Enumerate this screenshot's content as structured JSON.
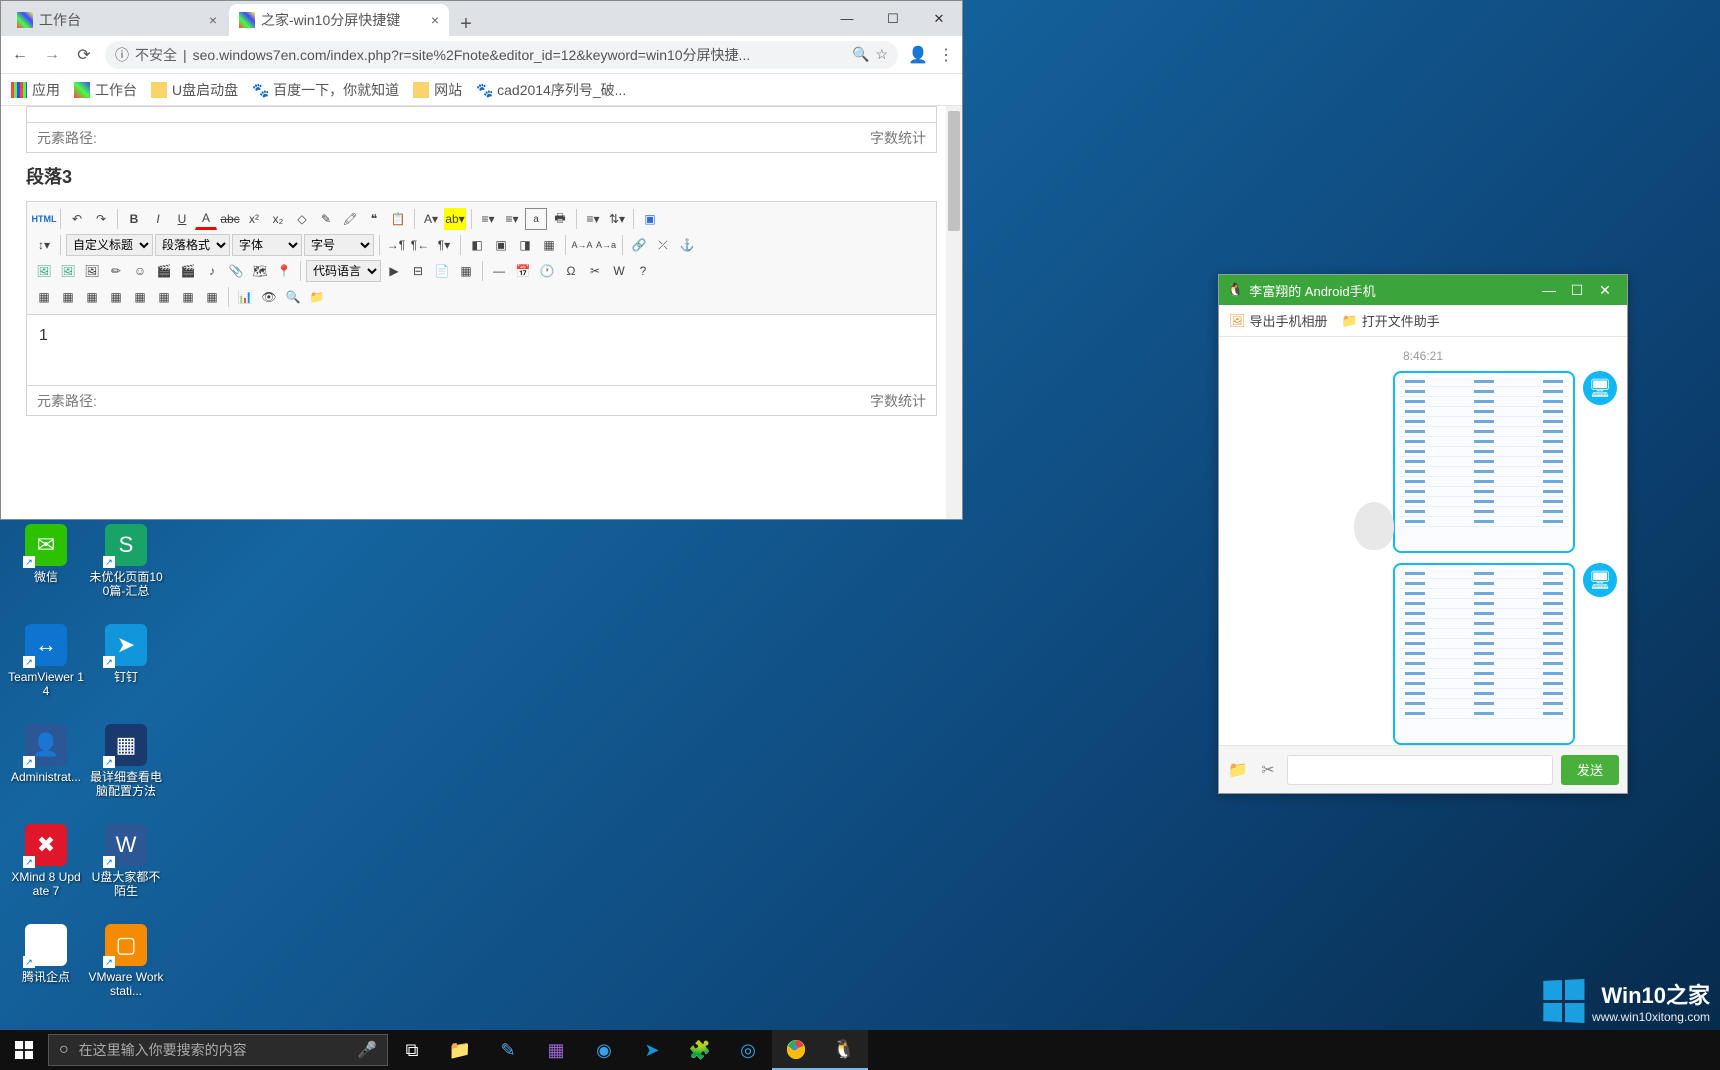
{
  "browser": {
    "tabs": [
      {
        "title": "工作台"
      },
      {
        "title": "之家-win10分屏快捷键"
      }
    ],
    "address": {
      "insecure_label": "不安全",
      "url": "seo.windows7en.com/index.php?r=site%2Fnote&editor_id=12&keyword=win10分屏快捷..."
    },
    "bookmarks": {
      "apps": "应用",
      "items": [
        "工作台",
        "U盘启动盘",
        "百度一下，你就知道",
        "网站",
        "cad2014序列号_破..."
      ]
    },
    "page": {
      "path_label": "元素路径:",
      "count_label": "字数统计",
      "section_title": "段落3",
      "toolbar": {
        "html": "HTML",
        "custom_title": "自定义标题",
        "para_fmt": "段落格式",
        "font": "字体",
        "size": "字号",
        "code_lang": "代码语言"
      },
      "content": "1"
    }
  },
  "qq": {
    "title": "李富翔的 Android手机",
    "export_album": "导出手机相册",
    "open_file": "打开文件助手",
    "timestamp": "8:46:21",
    "send": "发送"
  },
  "desktop": {
    "icons": [
      [
        {
          "label": "微信",
          "color": "#2dc100",
          "glyph": "✉"
        },
        {
          "label": "未优化页面100篇-汇总",
          "color": "#1aa366",
          "glyph": "S"
        }
      ],
      [
        {
          "label": "TeamViewer 14",
          "color": "#0e74d1",
          "glyph": "↔"
        },
        {
          "label": "钉钉",
          "color": "#1296db",
          "glyph": "➤"
        }
      ],
      [
        {
          "label": "Administrat...",
          "color": "#2b5797",
          "glyph": "👤"
        },
        {
          "label": "最详细查看电脑配置方法",
          "color": "#1a3a6e",
          "glyph": "▦"
        }
      ],
      [
        {
          "label": "XMind 8 Update 7",
          "color": "#e0162b",
          "glyph": "✖"
        },
        {
          "label": "U盘大家都不陌生",
          "color": "#2b5797",
          "glyph": "W"
        }
      ],
      [
        {
          "label": "腾讯企点",
          "color": "#ffffff",
          "glyph": "◭"
        },
        {
          "label": "VMware Workstati...",
          "color": "#f48b00",
          "glyph": "▢"
        }
      ]
    ]
  },
  "taskbar": {
    "search_placeholder": "在这里输入你要搜索的内容"
  },
  "watermark": {
    "title": "Win10之家",
    "url": "www.win10xitong.com"
  }
}
